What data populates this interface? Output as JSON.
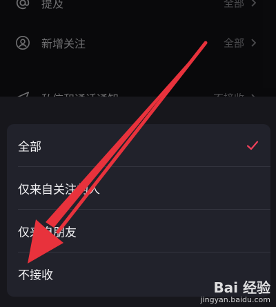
{
  "background_settings": {
    "rows": [
      {
        "icon": "at-icon",
        "label": "提及",
        "value": "全部"
      },
      {
        "icon": "person-circle-icon",
        "label": "新增关注",
        "value": "全部"
      },
      {
        "icon": "send-icon",
        "label": "私信和通话通知",
        "value": "不接收"
      }
    ]
  },
  "sheet": {
    "options": [
      {
        "label": "全部",
        "selected": true
      },
      {
        "label": "仅来自关注的人",
        "selected": false
      },
      {
        "label": "仅来自朋友",
        "selected": false
      },
      {
        "label": "不接收",
        "selected": false
      }
    ]
  },
  "annotation": {
    "arrow_color": "#e8323c"
  },
  "watermark": {
    "brand": "Bai 经验",
    "url": "jingyan.baidu.com"
  },
  "colors": {
    "check_accent": "#f0405a",
    "card_bg": "#21222b"
  }
}
